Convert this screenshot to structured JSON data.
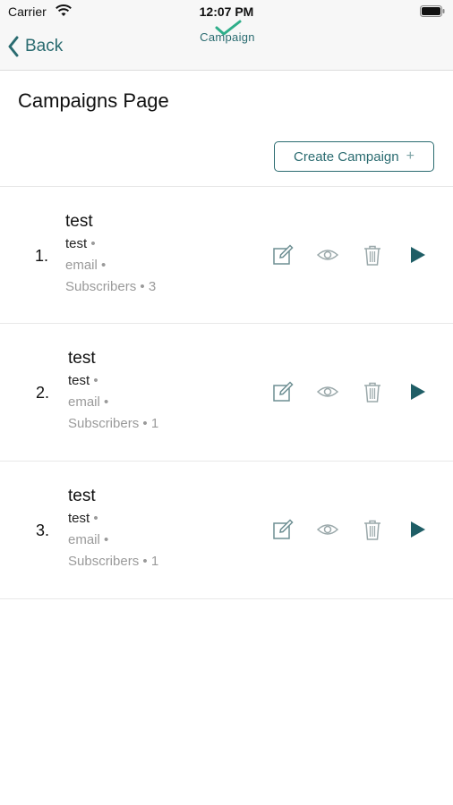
{
  "status_bar": {
    "carrier": "Carrier",
    "time": "12:07 PM"
  },
  "nav": {
    "back_label": "Back",
    "logo_text": "Campaign"
  },
  "page": {
    "title": "Campaigns Page",
    "create_button_label": "Create Campaign",
    "create_button_icon": "+"
  },
  "separator": "•",
  "colors": {
    "accent": "#2a6b70",
    "muted": "#9a9a9a",
    "play": "#1f5e66"
  },
  "campaigns": [
    {
      "index": "1.",
      "name": "test",
      "type": "test",
      "channel": "email",
      "subscribers_label": "Subscribers",
      "subscribers_count": "3"
    },
    {
      "index": "2.",
      "name": "test",
      "type": "test",
      "channel": "email",
      "subscribers_label": "Subscribers",
      "subscribers_count": "1"
    },
    {
      "index": "3.",
      "name": "test",
      "type": "test",
      "channel": "email",
      "subscribers_label": "Subscribers",
      "subscribers_count": "1"
    }
  ]
}
